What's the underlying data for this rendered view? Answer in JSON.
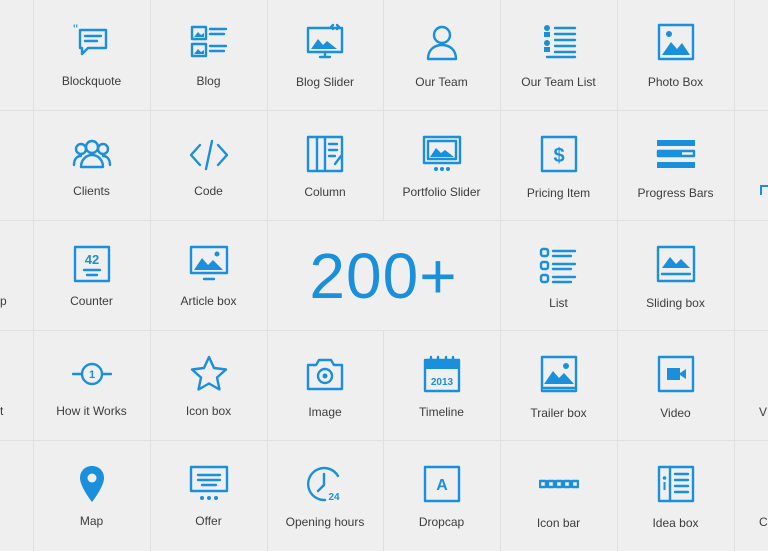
{
  "colors": {
    "accent": "#1a8fdb",
    "background": "#efefef",
    "divider": "#e0e0e0",
    "text": "#3c3c3c"
  },
  "headline": "200+",
  "rows": [
    {
      "items": [
        {
          "label": "Blockquote",
          "icon": "blockquote-icon"
        },
        {
          "label": "Blog",
          "icon": "blog-icon"
        },
        {
          "label": "Blog Slider",
          "icon": "blog-slider-icon"
        },
        {
          "label": "Our Team",
          "icon": "our-team-icon"
        },
        {
          "label": "Our Team List",
          "icon": "our-team-list-icon"
        },
        {
          "label": "Photo Box",
          "icon": "photo-box-icon"
        }
      ]
    },
    {
      "items": [
        {
          "label": "Clients",
          "icon": "clients-icon"
        },
        {
          "label": "Code",
          "icon": "code-icon"
        },
        {
          "label": "Column",
          "icon": "column-icon"
        },
        {
          "label": "Portfolio Slider",
          "icon": "portfolio-slider-icon"
        },
        {
          "label": "Pricing Item",
          "icon": "pricing-item-icon"
        },
        {
          "label": "Progress Bars",
          "icon": "progress-bars-icon"
        }
      ]
    },
    {
      "items": [
        {
          "label": "Counter",
          "icon": "counter-icon",
          "icon_text": "42"
        },
        {
          "label": "Article box",
          "icon": "article-box-icon"
        },
        {
          "label": "List",
          "icon": "list-icon"
        },
        {
          "label": "Sliding box",
          "icon": "sliding-box-icon"
        }
      ]
    },
    {
      "items": [
        {
          "label": "How it Works",
          "icon": "how-it-works-icon",
          "icon_text": "1"
        },
        {
          "label": "Icon box",
          "icon": "star-icon"
        },
        {
          "label": "Image",
          "icon": "camera-icon"
        },
        {
          "label": "Timeline",
          "icon": "calendar-icon",
          "icon_text": "2013"
        },
        {
          "label": "Trailer box",
          "icon": "trailer-box-icon"
        },
        {
          "label": "Video",
          "icon": "video-icon"
        }
      ]
    },
    {
      "items": [
        {
          "label": "Map",
          "icon": "map-pin-icon"
        },
        {
          "label": "Offer",
          "icon": "offer-icon"
        },
        {
          "label": "Opening hours",
          "icon": "clock-icon",
          "icon_text": "24"
        },
        {
          "label": "Dropcap",
          "icon": "dropcap-icon",
          "icon_text": "A"
        },
        {
          "label": "Icon bar",
          "icon": "icon-bar-icon"
        },
        {
          "label": "Idea box",
          "icon": "idea-box-icon"
        }
      ]
    }
  ],
  "edge_fragments": {
    "row3_left": "p",
    "row4_left": "t",
    "row4_right": "V",
    "row5_right": "C"
  }
}
